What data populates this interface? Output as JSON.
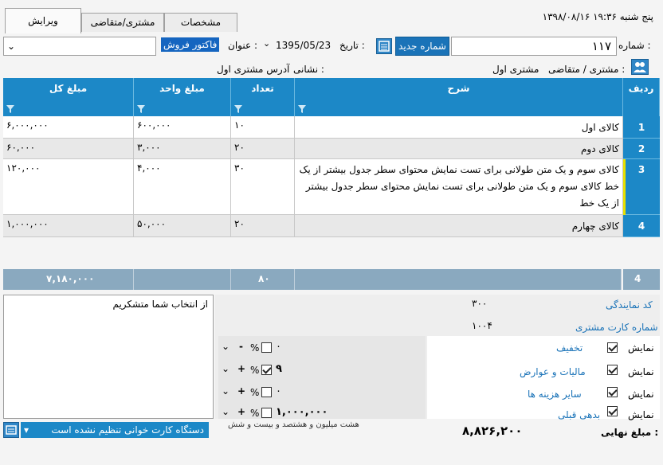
{
  "header": {
    "datetime": "۱۳۹۸/۰۸/۱۶ پنج شنبه ۱۹:۳۶",
    "tabs": [
      "ویرایش",
      "مشتری/متقاضی",
      "مشخصات"
    ],
    "number_label": "شماره :",
    "number_value": "۱۱۷",
    "new_number_button": "شماره جدید",
    "date_label": "تاریخ :",
    "date_value": "1395/05/23",
    "title_label": "عنوان :",
    "title_value": "فاکتور فروش",
    "customer_label": "مشتری / متقاضی :",
    "customer_value": "مشتری اول",
    "address_label": "نشانی :",
    "address_value": "آدرس مشتری اول"
  },
  "table": {
    "columns": [
      "ردیف",
      "شرح",
      "تعداد",
      "مبلغ واحد",
      "مبلغ کل"
    ],
    "rows": [
      {
        "num": "1",
        "desc": "کالای اول",
        "qty": "۱۰",
        "unit": "۶۰۰,۰۰۰",
        "total": "۶,۰۰۰,۰۰۰"
      },
      {
        "num": "2",
        "desc": "کالای دوم",
        "qty": "۲۰",
        "unit": "۳,۰۰۰",
        "total": "۶۰,۰۰۰"
      },
      {
        "num": "3",
        "desc": "کالای سوم و یک متن طولانی برای تست نمایش محتوای سطر جدول بیشتر از یک خط کالای سوم و یک متن طولانی برای تست نمایش محتوای سطر جدول بیشتر از یک خط",
        "qty": "۳۰",
        "unit": "۴,۰۰۰",
        "total": "۱۲۰,۰۰۰"
      },
      {
        "num": "4",
        "desc": "کالای چهارم",
        "qty": "۲۰",
        "unit": "۵۰,۰۰۰",
        "total": "۱,۰۰۰,۰۰۰"
      }
    ],
    "footer": {
      "count": "4",
      "qty": "۸۰",
      "total": "۷,۱۸۰,۰۰۰"
    }
  },
  "bottom": {
    "memo": "از انتخاب شما متشکریم",
    "rep_code_label": "کد نمایندگی",
    "rep_code_value": "۳۰۰",
    "card_label": "شماره کارت مشتری",
    "card_value": "۱۰۰۴",
    "show_label": "نمایش",
    "items": [
      {
        "label": "تخفیف",
        "value": "۰",
        "pct_checked": false,
        "sign": "-"
      },
      {
        "label": "مالیات و عوارض",
        "value": "۹",
        "pct_checked": true,
        "sign": "+"
      },
      {
        "label": "سایر هزینه ها",
        "value": "۰",
        "pct_checked": false,
        "sign": "+"
      },
      {
        "label": "بدهی قبلی",
        "value": "۱,۰۰۰,۰۰۰",
        "pct_checked": false,
        "sign": "+"
      }
    ],
    "pct_symbol": "%",
    "final_label": "مبلغ نهایی :",
    "final_value": "۸,۸۲۶,۲۰۰",
    "final_words": "هشت میلیون و هشتصد و بیست و شش",
    "status_text": "دستگاه کارت خوانی تنظیم نشده است",
    "accent": "#1c88c7"
  }
}
